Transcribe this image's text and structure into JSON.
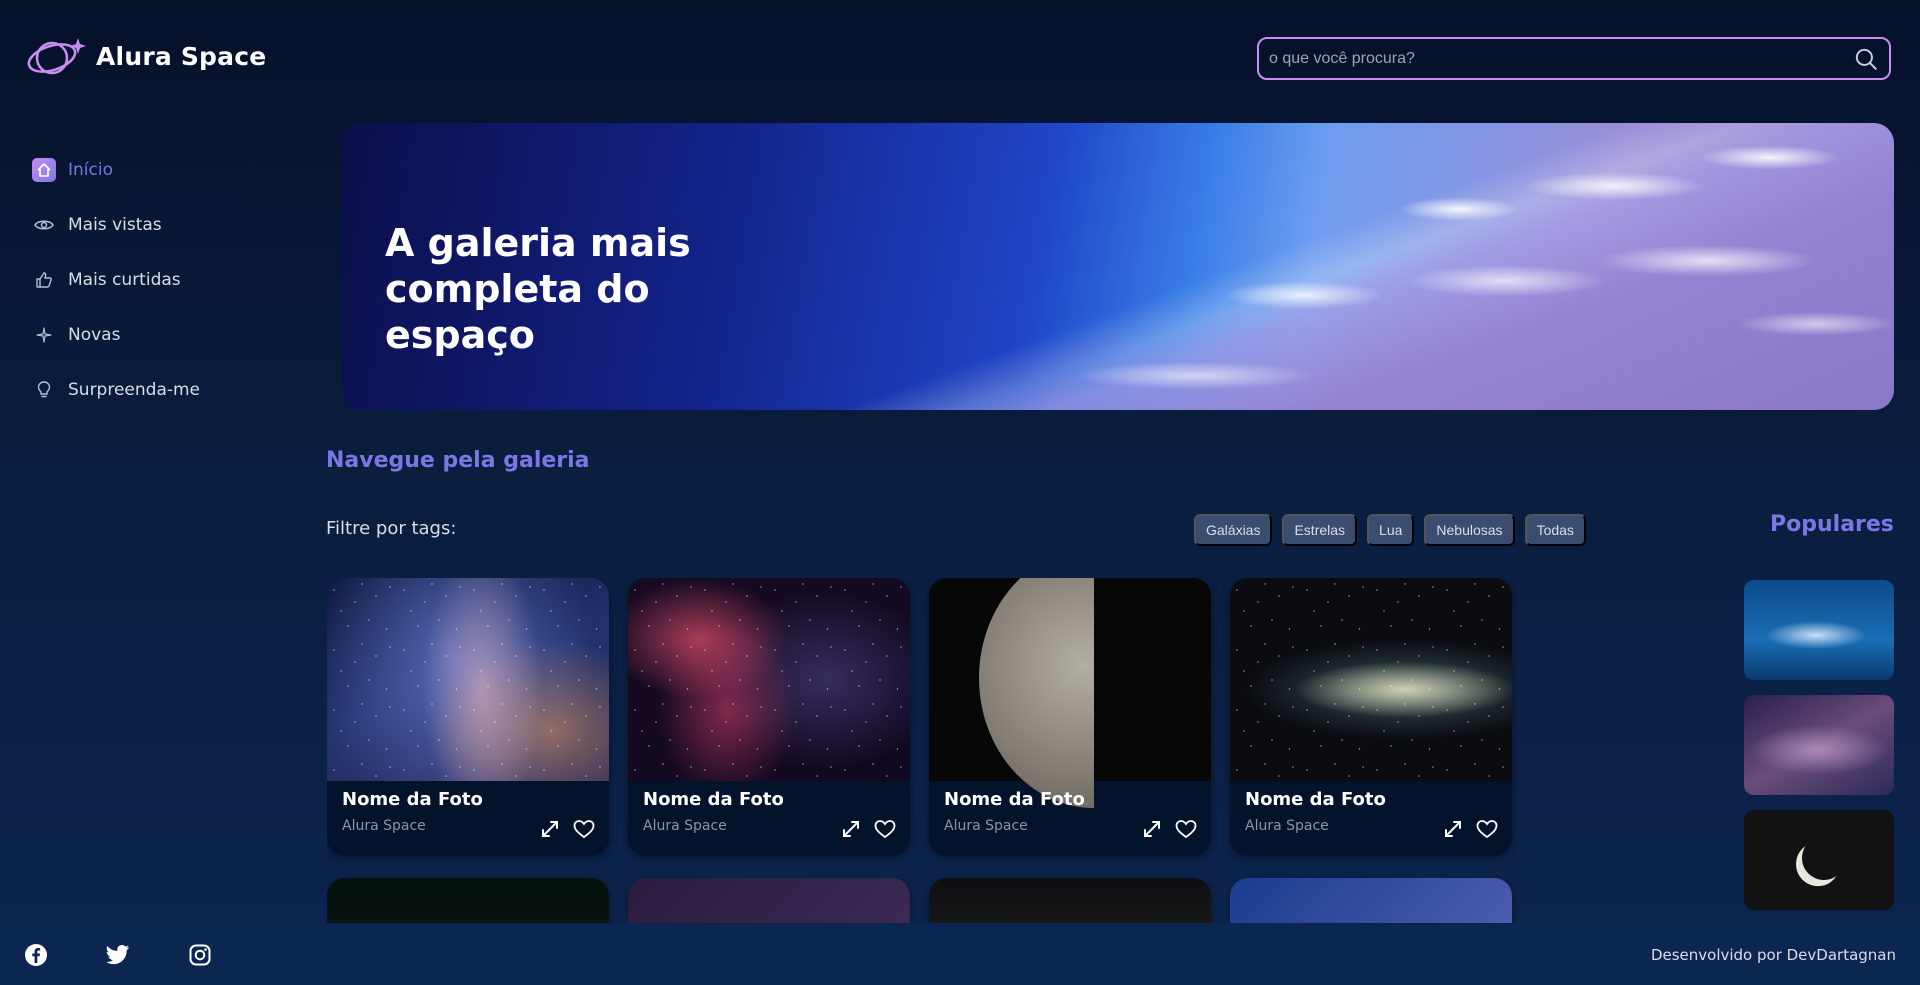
{
  "header": {
    "logo_text": "Alura Space",
    "search_placeholder": "o que você procura?"
  },
  "sidebar": {
    "items": [
      {
        "label": "Início",
        "icon": "home-icon",
        "active": true
      },
      {
        "label": "Mais vistas",
        "icon": "eye-icon",
        "active": false
      },
      {
        "label": "Mais curtidas",
        "icon": "thumbs-up-icon",
        "active": false
      },
      {
        "label": "Novas",
        "icon": "sparkle-icon",
        "active": false
      },
      {
        "label": "Surpreenda-me",
        "icon": "lightbulb-icon",
        "active": false
      }
    ]
  },
  "banner": {
    "title": "A galeria mais completa do espaço"
  },
  "gallery": {
    "title": "Navegue pela galeria",
    "filter_label": "Filtre por tags:",
    "tags": [
      "Galáxias",
      "Estrelas",
      "Lua",
      "Nebulosas",
      "Todas"
    ],
    "cards": [
      {
        "name": "Nome da Foto",
        "author": "Alura Space",
        "image": "milky-way"
      },
      {
        "name": "Nome da Foto",
        "author": "Alura Space",
        "image": "nebula"
      },
      {
        "name": "Nome da Foto",
        "author": "Alura Space",
        "image": "moon"
      },
      {
        "name": "Nome da Foto",
        "author": "Alura Space",
        "image": "andromeda"
      }
    ]
  },
  "populares": {
    "title": "Populares"
  },
  "footer": {
    "credit": "Desenvolvido por DevDartagnan",
    "socials": [
      "facebook-icon",
      "twitter-icon",
      "instagram-icon"
    ]
  },
  "colors": {
    "accent": "#7b78e5",
    "accent_border": "#c98cf1",
    "background": "#0a1d3d",
    "tag_bg": "#3a4d6e"
  }
}
